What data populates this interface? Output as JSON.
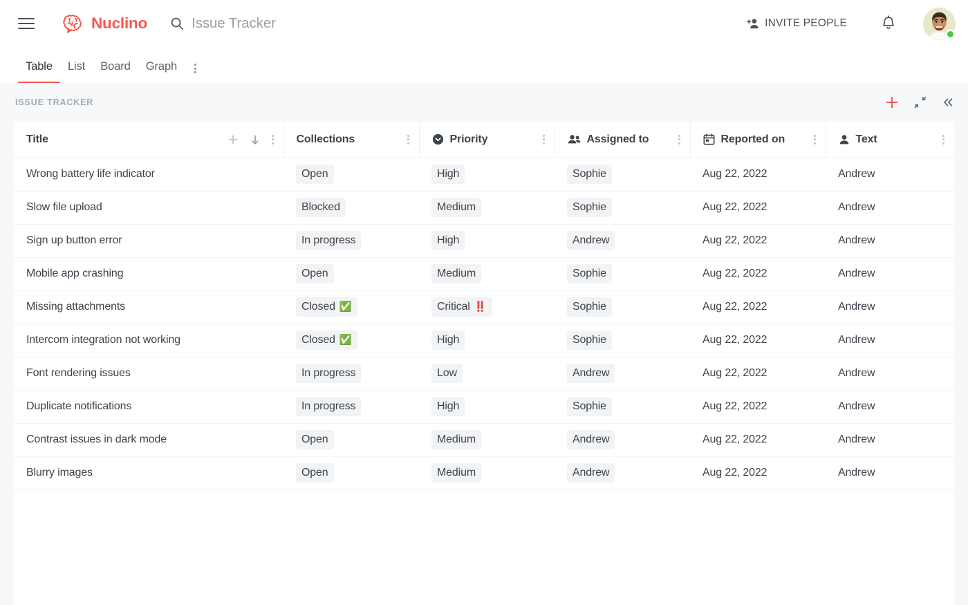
{
  "topbar": {
    "menu_icon": "hamburger-icon",
    "brand_name": "Nuclino",
    "brand_icon": "nuclino-brain-logo-icon",
    "search_icon": "search-icon",
    "search_value": "Issue Tracker",
    "search_placeholder": "Search",
    "invite_icon": "person-add-icon",
    "invite_label": "INVITE PEOPLE",
    "bell_icon": "bell-icon",
    "avatar_name": "user-avatar",
    "status": "online"
  },
  "tabs": {
    "items": [
      {
        "label": "Table",
        "active": true
      },
      {
        "label": "List",
        "active": false
      },
      {
        "label": "Board",
        "active": false
      },
      {
        "label": "Graph",
        "active": false
      }
    ],
    "more_icon": "kebab-menu-icon"
  },
  "page": {
    "title": "ISSUE TRACKER",
    "actions": [
      {
        "name": "add-item-button",
        "icon": "plus-icon"
      },
      {
        "name": "collapse-button",
        "icon": "collapse-corners-icon"
      },
      {
        "name": "hide-sidebar-button",
        "icon": "double-chevron-left-icon"
      }
    ]
  },
  "colors": {
    "accent": "#f4594f",
    "page_bg": "#f7f8fa",
    "text": "#3d444c",
    "muted": "#a4aab3",
    "chip_bg": "#f2f3f5",
    "status_online": "#4ec54a"
  },
  "table": {
    "columns": [
      {
        "label": "Title",
        "icon": "",
        "tools": [
          "plus-icon",
          "sort-down-icon",
          "kebab-menu-icon"
        ]
      },
      {
        "label": "Collections",
        "icon": "",
        "tools": [
          "kebab-menu-icon"
        ]
      },
      {
        "label": "Priority",
        "icon": "select-circle-icon",
        "tools": [
          "kebab-menu-icon"
        ]
      },
      {
        "label": "Assigned to",
        "icon": "people-icon",
        "tools": [
          "kebab-menu-icon"
        ]
      },
      {
        "label": "Reported on",
        "icon": "calendar-icon",
        "tools": [
          "kebab-menu-icon"
        ]
      },
      {
        "label": "Text",
        "icon": "person-icon",
        "tools": [
          "kebab-menu-icon"
        ]
      }
    ],
    "rows": [
      {
        "title": "Wrong battery life indicator",
        "collection": "Open",
        "collection_emoji": "",
        "priority": "High",
        "priority_emoji": "",
        "assigned": "Sophie",
        "reported": "Aug 22, 2022",
        "text": "Andrew"
      },
      {
        "title": "Slow file upload",
        "collection": "Blocked",
        "collection_emoji": "",
        "priority": "Medium",
        "priority_emoji": "",
        "assigned": "Sophie",
        "reported": "Aug 22, 2022",
        "text": "Andrew"
      },
      {
        "title": "Sign up button error",
        "collection": "In progress",
        "collection_emoji": "",
        "priority": "High",
        "priority_emoji": "",
        "assigned": "Andrew",
        "reported": "Aug 22, 2022",
        "text": "Andrew"
      },
      {
        "title": "Mobile app crashing",
        "collection": "Open",
        "collection_emoji": "",
        "priority": "Medium",
        "priority_emoji": "",
        "assigned": "Sophie",
        "reported": "Aug 22, 2022",
        "text": "Andrew"
      },
      {
        "title": "Missing attachments",
        "collection": "Closed",
        "collection_emoji": "✅",
        "priority": "Critical",
        "priority_emoji": "‼️",
        "assigned": "Sophie",
        "reported": "Aug 22, 2022",
        "text": "Andrew"
      },
      {
        "title": "Intercom integration not working",
        "collection": "Closed",
        "collection_emoji": "✅",
        "priority": "High",
        "priority_emoji": "",
        "assigned": "Sophie",
        "reported": "Aug 22, 2022",
        "text": "Andrew"
      },
      {
        "title": "Font rendering issues",
        "collection": "In progress",
        "collection_emoji": "",
        "priority": "Low",
        "priority_emoji": "",
        "assigned": "Andrew",
        "reported": "Aug 22, 2022",
        "text": "Andrew"
      },
      {
        "title": "Duplicate notifications",
        "collection": "In progress",
        "collection_emoji": "",
        "priority": "High",
        "priority_emoji": "",
        "assigned": "Sophie",
        "reported": "Aug 22, 2022",
        "text": "Andrew"
      },
      {
        "title": "Contrast issues in dark mode",
        "collection": "Open",
        "collection_emoji": "",
        "priority": "Medium",
        "priority_emoji": "",
        "assigned": "Andrew",
        "reported": "Aug 22, 2022",
        "text": "Andrew"
      },
      {
        "title": "Blurry images",
        "collection": "Open",
        "collection_emoji": "",
        "priority": "Medium",
        "priority_emoji": "",
        "assigned": "Andrew",
        "reported": "Aug 22, 2022",
        "text": "Andrew"
      }
    ]
  }
}
